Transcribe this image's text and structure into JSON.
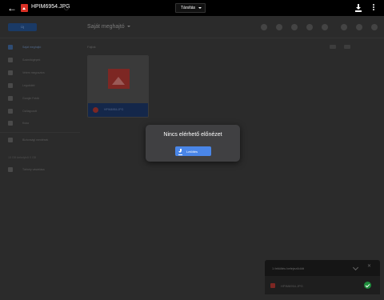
{
  "viewer": {
    "file_name": "HPIM6954.JPG",
    "share_label": "Társítás"
  },
  "drive": {
    "new_button": "Új",
    "breadcrumb": "Saját meghajtó",
    "files_label": "Fájlok",
    "sidebar": [
      {
        "label": "Saját meghajtó",
        "icon": "drive-icon",
        "active": true
      },
      {
        "label": "Számítógépek",
        "icon": "computer-icon",
        "active": false
      },
      {
        "label": "Velem megosztva",
        "icon": "shared-icon",
        "active": false
      },
      {
        "label": "Legutóbbi",
        "icon": "clock-icon",
        "active": false
      },
      {
        "label": "Google Fotók",
        "icon": "photos-icon",
        "active": false
      },
      {
        "label": "Csillagozott",
        "icon": "star-icon",
        "active": false
      },
      {
        "label": "Kuka",
        "icon": "trash-icon",
        "active": false
      },
      {
        "label": "Biztonsági mentések",
        "icon": "cloud-icon",
        "active": false
      },
      {
        "label": "Tárhely vásárlása",
        "icon": "storage-icon",
        "active": false
      }
    ],
    "storage_text": "15 GB tárhelyből 0 GB",
    "file_card": {
      "name": "HPIM6954.JPG"
    }
  },
  "modal": {
    "title": "Nincs elérhető előnézet",
    "download_label": "Letöltés"
  },
  "upload_panel": {
    "title": "1 feltöltés befejeződött",
    "file_name": "HPIM6954.JPG"
  },
  "colors": {
    "accent": "#4a86e8",
    "modal_bg": "#404042",
    "success": "#1f8e3d",
    "file_red": "#d93025"
  }
}
